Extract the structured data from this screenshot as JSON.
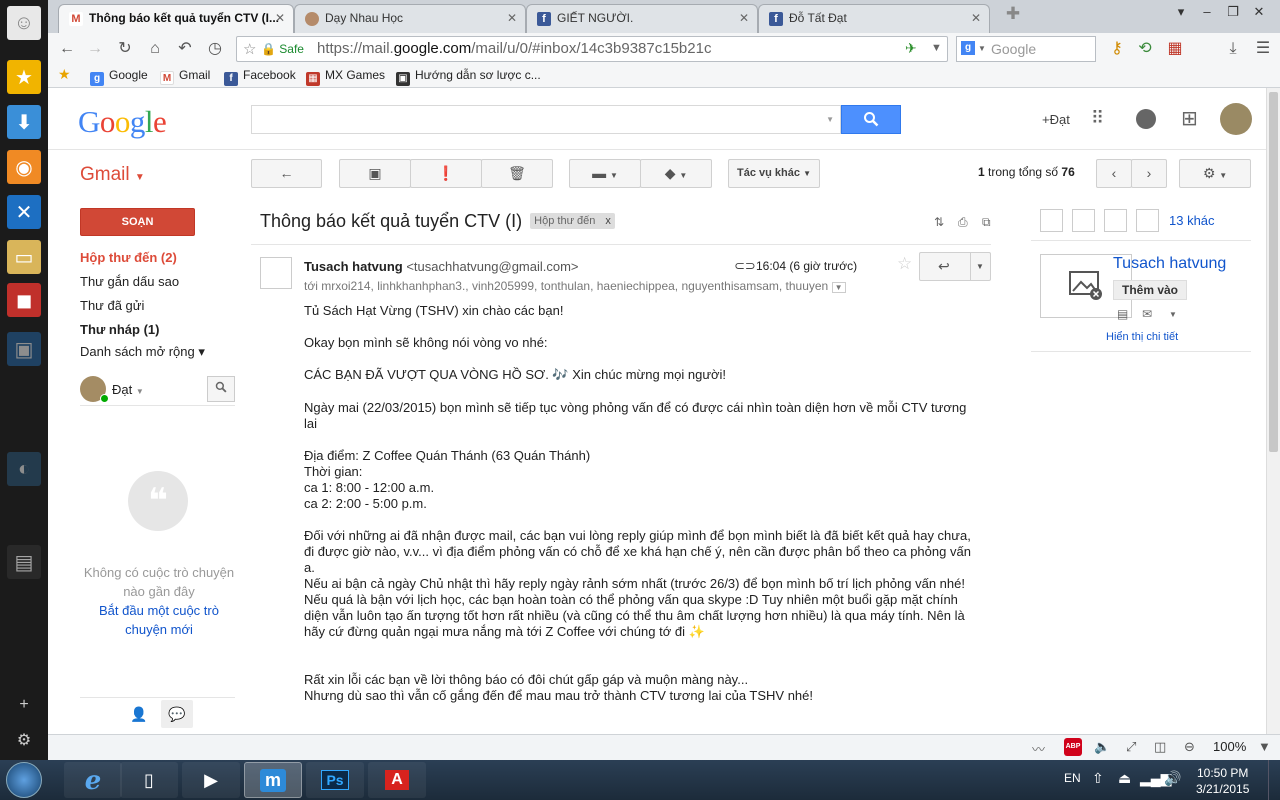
{
  "browser": {
    "tabs": [
      {
        "label": "Thông báo kết quả tuyển CTV (I...",
        "icon": "gmail-icon",
        "active": true
      },
      {
        "label": "Dạy Nhau Học",
        "icon": "avatar-icon",
        "active": false
      },
      {
        "label": "GIẾT NGƯỜI.",
        "icon": "facebook-icon",
        "active": false
      },
      {
        "label": "Đỗ Tất Đạt",
        "icon": "facebook-icon",
        "active": false
      }
    ],
    "url_safe": "Safe",
    "url_prefix": "https://mail.",
    "url_domain": "google.com",
    "url_rest": "/mail/u/0/#inbox/14c3b9387c15b21c",
    "search_placeholder": "Google",
    "bookmarks": [
      {
        "label": "Google",
        "color": "#4285f4"
      },
      {
        "label": "Gmail",
        "color": "#d14836"
      },
      {
        "label": "Facebook",
        "color": "#3b5998"
      },
      {
        "label": "MX Games",
        "color": "#c0392b"
      },
      {
        "label": "Hướng dẫn sơ lược c...",
        "color": "#333333"
      }
    ]
  },
  "gmail": {
    "logo": "Google",
    "plus_user": "+Đạt",
    "app_label": "Gmail",
    "more_actions": "Tác vụ khác",
    "pager_current": "1",
    "pager_mid": " trong tổng số ",
    "pager_total": "76",
    "compose": "SOẠN",
    "nav": [
      {
        "label": "Hộp thư đến (2)",
        "style": "active"
      },
      {
        "label": "Thư gắn dấu sao",
        "style": ""
      },
      {
        "label": "Thư đã gửi",
        "style": ""
      },
      {
        "label": "Thư nháp (1)",
        "style": "bold"
      },
      {
        "label": "Danh sách mở rộng ▾",
        "style": ""
      }
    ],
    "hangouts_user": "Đạt",
    "hangouts_empty": "Không có cuộc trò chuyện nào gần đây",
    "hangouts_start": "Bắt đầu một cuộc trò chuyện mới"
  },
  "message": {
    "subject": "Thông báo kết quả tuyển CTV (I)",
    "label_tag": "Hộp thư đến",
    "sender_name": "Tusach hatvung",
    "sender_email": "<tusachhatvung@gmail.com>",
    "time": "16:04 (6 giờ trước)",
    "recipients": "tới mrxoi214, linhkhanhphan3., vinh205999, tonthulan, haeniechippea, nguyenthisamsam, thuuyen",
    "body": [
      "Tủ Sách Hạt Vừng (TSHV) xin chào các bạn!",
      "Okay bọn mình sẽ không nói vòng vo nhé:",
      "CÁC BẠN ĐÃ VƯỢT QUA VÒNG HỒ SƠ. 🎶 Xin chúc mừng mọi người!",
      "Ngày mai (22/03/2015) bọn mình sẽ tiếp tục vòng phỏng vấn để có được cái nhìn toàn diện hơn về mỗi CTV tương",
      "lai",
      "Địa điểm: Z Coffee Quán Thánh (63 Quán Thánh)",
      "Thời gian:",
      "ca 1: 8:00 - 12:00 a.m.",
      "ca 2: 2:00 - 5:00 p.m.",
      "Đối với những ai đã nhận được mail, các bạn vui lòng reply giúp mình để bọn mình biết là đã biết kết quả hay chưa,",
      "đi được giờ nào, v.v... vì địa điểm phỏng vấn có chỗ để xe khá hạn chế ý, nên cần được phân bổ theo ca phỏng vấn",
      "a.",
      "Nếu ai bận cả ngày Chủ nhật thì hãy reply ngày rảnh sớm nhất (trước 26/3) để bọn mình bố trí lịch phỏng vấn nhé!",
      "Nếu quá là bận với lịch học, các bạn hoàn toàn có thể phỏng vấn qua skype :D Tuy nhiên một buổi gặp mặt chính",
      "diện vẫn luôn tạo ấn tượng tốt hơn rất nhiều (và cũng có thể thu âm chất lượng hơn nhiều) là qua máy tính. Nên là",
      "hãy cứ đừng quản ngại mưa nắng mà tới Z Coffee với chúng tớ đi ✨",
      "Rất xin lỗi các bạn về lời thông báo có đôi chút gấp gáp và muộn màng này...",
      "Nhưng dù sao thì vẫn cố gắng đến để mau mau trở thành CTV tương lai của TSHV nhé!"
    ]
  },
  "right_panel": {
    "more": "13 khác",
    "contact_name": "Tusach hatvung",
    "add_button": "Thêm vào",
    "details_link": "Hiển thị chi tiết"
  },
  "statusbar": {
    "zoom": "100%"
  },
  "taskbar": {
    "lang": "EN",
    "time": "10:50 PM",
    "date": "3/21/2015"
  },
  "colors": {
    "gmail_red": "#dd4b39",
    "compose_red": "#d14836",
    "search_blue": "#4d90fe",
    "link_blue": "#1155cc"
  }
}
